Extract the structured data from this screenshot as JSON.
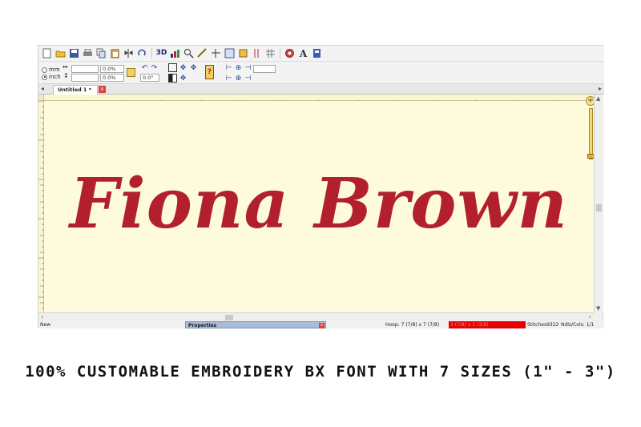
{
  "toolbar": {
    "mode_label": "3D",
    "text_tool_label": "A"
  },
  "units": {
    "mm": "mm",
    "inch": "inch"
  },
  "properties_bar": {
    "width_value": "",
    "height_value": "",
    "width_scale": "0.0%",
    "height_scale": "0.0%",
    "rotation": "0.0°"
  },
  "tabs": {
    "document_tab": "Untitled 1 *",
    "close_glyph": "x"
  },
  "design": {
    "text": "Fiona Brown",
    "thread_color": "#b2202e"
  },
  "status": {
    "left": "New",
    "properties_panel": "Properties",
    "hoop": "Hoop: 7 (7/8) x 7 (7/8)",
    "design_size": "3 (7/8) x 1 (3/8)",
    "stitches": "Stitches9322",
    "needles": "Ndls/Cols: 1/1"
  },
  "caption": "100% CUSTOMABLE EMBROIDERY BX FONT WITH 7 SIZES (1\" -  3\")",
  "colors": {
    "canvas_bg": "#fefbdc",
    "accent_red": "#e60000"
  }
}
